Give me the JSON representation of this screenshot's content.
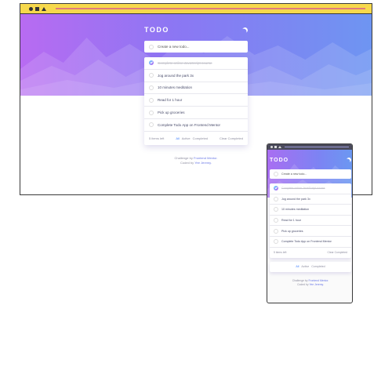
{
  "app": {
    "title": "TODO",
    "new_todo_placeholder": "Create a new todo...",
    "todos": [
      {
        "text": "Complete online JavaScript course",
        "completed": true
      },
      {
        "text": "Jog around the park 3x",
        "completed": false
      },
      {
        "text": "10 minutes meditation",
        "completed": false
      },
      {
        "text": "Read for 1 hour",
        "completed": false
      },
      {
        "text": "Pick up groceries",
        "completed": false
      },
      {
        "text": "Complete Todo App on Frontend Mentor",
        "completed": false
      }
    ],
    "items_left": "5 items left",
    "filters": [
      "All",
      "Active",
      "Completed"
    ],
    "active_filter": "All",
    "clear_completed": "Clear Completed",
    "credit_line1": "Challenge by",
    "credit_link1": "Frontend Mentor.",
    "credit_line2": "Coded by",
    "credit_link2": "Yee Jeremy."
  },
  "colors": {
    "browser_bar": "#f7d94c",
    "gradient_start": "#b86bf2",
    "gradient_end": "#6e95f2",
    "active_filter": "#3a7bfd",
    "check_gradient_start": "#57ddff",
    "check_gradient_end": "#c058f3"
  },
  "icons": {
    "theme_toggle": "moon-icon",
    "check": "check-icon"
  }
}
